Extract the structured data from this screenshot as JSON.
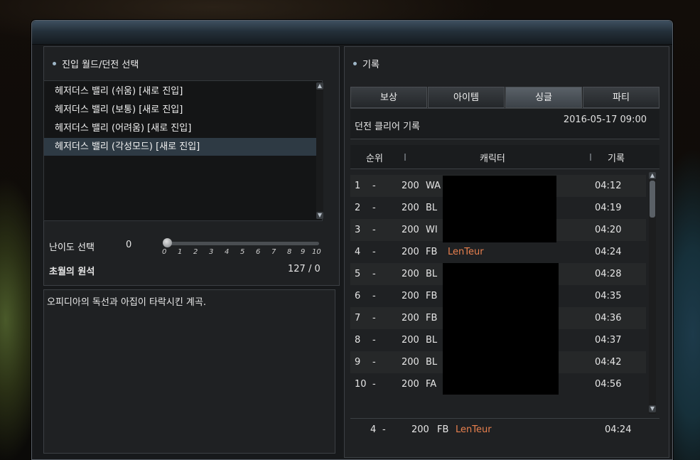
{
  "left": {
    "title": "진입 월드/던전 선택",
    "dungeons": [
      "헤저더스 밸리 (쉬움) [새로 진입]",
      "헤저더스 밸리 (보통) [새로 진입]",
      "헤저더스 밸리 (어려움) [새로 진입]",
      "헤저더스 밸리 (각성모드) [새로 진입]"
    ],
    "difficulty_label": "난이도 선택",
    "difficulty_value": "0",
    "difficulty_ticks": [
      "0",
      "1",
      "2",
      "3",
      "4",
      "5",
      "6",
      "7",
      "8",
      "9",
      "10"
    ],
    "stone_label": "초월의 원석",
    "stone_value": "127 / 0",
    "description": "오피디아의 독선과 아집이 타락시킨 계곡."
  },
  "right": {
    "title": "기록",
    "tabs": [
      "보상",
      "아이템",
      "싱글",
      "파티"
    ],
    "active_tab": "싱글",
    "records_title": "던전 클리어 기록",
    "records_date": "2016-05-17 09:00",
    "col_rank": "순위",
    "col_character": "캐릭터",
    "col_record": "기록",
    "rows": [
      {
        "rank": "1",
        "dash": "-",
        "level": "200",
        "cls": "WA",
        "char": "",
        "record": "04:12"
      },
      {
        "rank": "2",
        "dash": "-",
        "level": "200",
        "cls": "BL",
        "char": "",
        "record": "04:19"
      },
      {
        "rank": "3",
        "dash": "-",
        "level": "200",
        "cls": "WI",
        "char": "",
        "record": "04:20"
      },
      {
        "rank": "4",
        "dash": "-",
        "level": "200",
        "cls": "FB",
        "char": "LenTeur",
        "record": "04:24"
      },
      {
        "rank": "5",
        "dash": "-",
        "level": "200",
        "cls": "BL",
        "char": "",
        "record": "04:28"
      },
      {
        "rank": "6",
        "dash": "-",
        "level": "200",
        "cls": "FB",
        "char": "",
        "record": "04:35"
      },
      {
        "rank": "7",
        "dash": "-",
        "level": "200",
        "cls": "FB",
        "char": "",
        "record": "04:36"
      },
      {
        "rank": "8",
        "dash": "-",
        "level": "200",
        "cls": "BL",
        "char": "",
        "record": "04:37"
      },
      {
        "rank": "9",
        "dash": "-",
        "level": "200",
        "cls": "BL",
        "char": "",
        "record": "04:42"
      },
      {
        "rank": "10",
        "dash": "-",
        "level": "200",
        "cls": "FA",
        "char": "",
        "record": "04:56"
      }
    ],
    "my_row": {
      "rank": "4",
      "dash": "-",
      "level": "200",
      "cls": "FB",
      "char": "LenTeur",
      "record": "04:24"
    }
  },
  "colors": {
    "character_name": "#e9804e",
    "window_bg": "#17191b",
    "accent": "#9fb7c8"
  }
}
